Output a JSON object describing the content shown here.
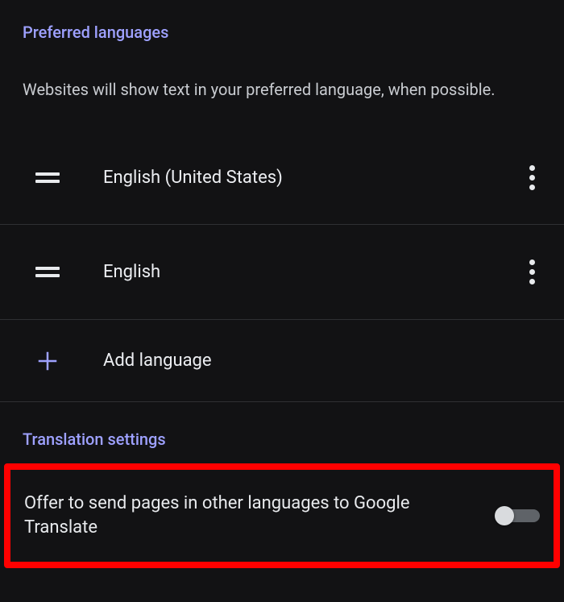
{
  "preferred": {
    "title": "Preferred languages",
    "description": "Websites will show text in your preferred language, when possible.",
    "items": [
      {
        "label": "English (United States)"
      },
      {
        "label": "English"
      }
    ],
    "add_label": "Add language"
  },
  "translation": {
    "title": "Translation settings",
    "toggle_label": "Offer to send pages in other languages to Google Translate",
    "toggle_state": "off"
  }
}
